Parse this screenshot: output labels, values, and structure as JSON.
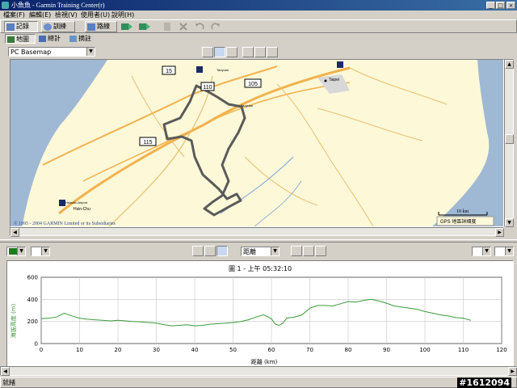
{
  "window": {
    "title": "小魚魚 - Garmin Training Center(r)",
    "min": "_",
    "max": "□",
    "close": "×"
  },
  "menu": [
    "檔案(F)",
    "編輯(E)",
    "檢視(V)",
    "使用者(U)",
    "說明(H)"
  ],
  "toolbar": {
    "history": "記錄",
    "training": "訓練",
    "routes": "路線"
  },
  "tabs": {
    "map": "地圖",
    "stats": "總計",
    "summary": "摘註"
  },
  "map": {
    "basemap": "PC Basemap",
    "labels": {
      "r15": "15",
      "r105": "105",
      "r115": "115",
      "r110": "110",
      "taipei": "Taipei",
      "hsinchu_air": "Hsinchu Airport",
      "hsin_chu": "Hsin-Chu",
      "taoyuan": "Taoyuan"
    },
    "copyright": "© 1995 - 2004 GARMIN Limited or its Subsidiaries",
    "scale": "10 km",
    "gps_label": "GPS 地區詳細度",
    "colors": {
      "land": "#fdf8d8",
      "sea": "#9fb8d4",
      "road": "#f2b24d",
      "track": "#5a5a5a"
    }
  },
  "elevation": {
    "color_select": "",
    "x_axis_mode": "距離",
    "right_select_1": "",
    "right_select_2": ""
  },
  "chart_data": {
    "type": "line",
    "title": "圖 1 - 上午 05:32:10",
    "xlabel": "距離 (km)",
    "ylabel": "海拔高度 (m)",
    "xlim": [
      0,
      120
    ],
    "ylim": [
      0,
      600
    ],
    "xticks": [
      0,
      10,
      20,
      30,
      40,
      50,
      60,
      70,
      80,
      90,
      100,
      110,
      120
    ],
    "yticks": [
      0,
      200,
      400,
      600
    ],
    "grid": true,
    "series": [
      {
        "color": "#3c9a3c",
        "x": [
          0,
          2,
          4,
          6,
          8,
          10,
          12,
          14,
          16,
          18,
          20,
          22,
          24,
          26,
          28,
          30,
          32,
          34,
          36,
          38,
          40,
          42,
          44,
          46,
          48,
          50,
          52,
          54,
          56,
          58,
          60,
          61,
          62,
          63,
          64,
          66,
          68,
          70,
          72,
          74,
          76,
          78,
          80,
          82,
          84,
          86,
          88,
          90,
          92,
          94,
          96,
          98,
          100,
          102,
          104,
          106,
          108,
          110,
          112
        ],
        "y": [
          225,
          230,
          240,
          275,
          250,
          230,
          220,
          215,
          210,
          205,
          210,
          205,
          200,
          195,
          190,
          185,
          170,
          160,
          165,
          170,
          160,
          165,
          175,
          180,
          185,
          190,
          200,
          215,
          240,
          260,
          225,
          175,
          165,
          185,
          230,
          240,
          260,
          320,
          345,
          345,
          340,
          360,
          380,
          375,
          390,
          400,
          385,
          365,
          340,
          330,
          320,
          310,
          290,
          275,
          260,
          250,
          235,
          230,
          210
        ]
      }
    ]
  },
  "status": {
    "text": "就緒",
    "code": "#1612094"
  }
}
